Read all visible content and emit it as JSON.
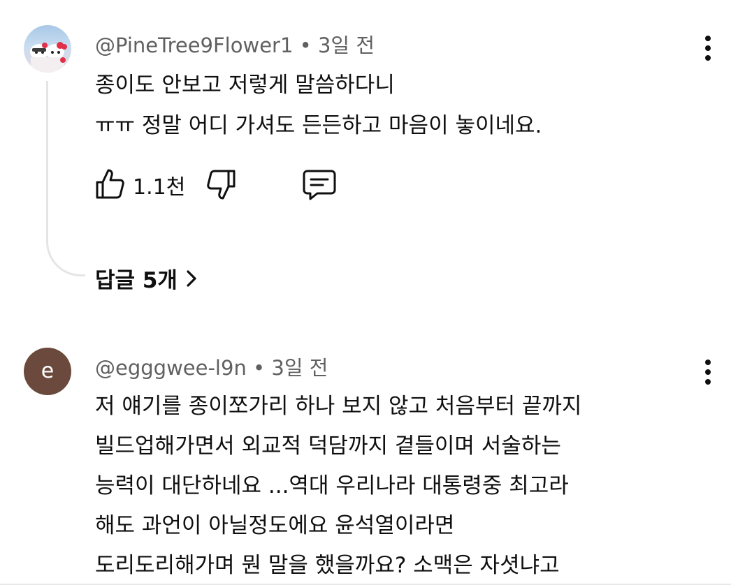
{
  "comments": [
    {
      "username": "@PineTree9Flower1",
      "age": "3일 전",
      "lines": [
        "종이도 안보고 저렇게 말씀하다니",
        "ㅠㅠ 정말 어디 가셔도 든든하고 마음이 놓이네요."
      ],
      "like_count": "1.1천",
      "replies_label": "답글 5개"
    },
    {
      "username": "@egggwee-l9n",
      "avatar_letter": "e",
      "age": "3일 전",
      "lines": [
        "저 얘기를 종이쪼가리 하나 보지 않고 처음부터 끝까지",
        "빌드업해가면서 외교적 덕담까지 곁들이며 서술하는",
        "능력이 대단하네요 ...역대 우리나라 대통령중 최고라",
        "해도 과언이 아닐정도에요 윤석열이라면",
        "도리도리해가며 뭔 말을 했을까요? 소맥은 자셧냐고"
      ]
    }
  ],
  "separator": "•",
  "icons": {
    "like": "thumbs-up-icon",
    "dislike": "thumbs-down-icon",
    "reply": "comment-icon",
    "more": "more-vert-icon",
    "chevron": "chevron-right-icon"
  },
  "colors": {
    "meta": "#606060",
    "text": "#0f0f0f",
    "avatar_e": "#6b4a3d",
    "thread_line": "#e5e5e5"
  }
}
